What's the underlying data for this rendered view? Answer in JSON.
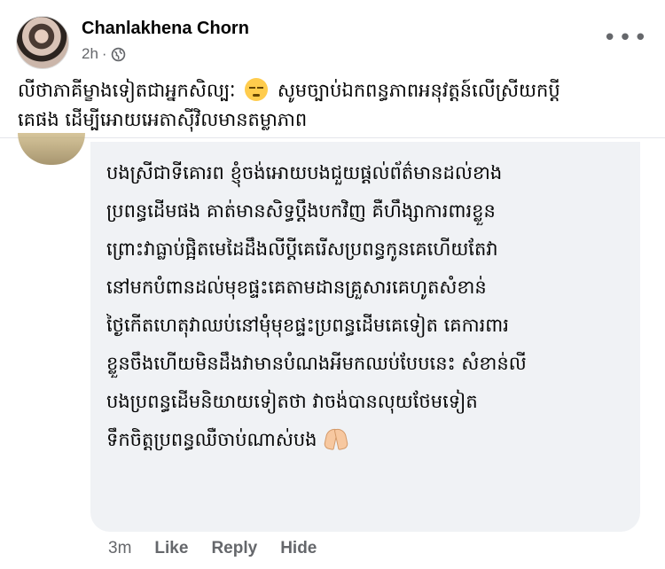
{
  "post": {
    "author": "Chanlakhena Chorn",
    "time": "2h",
    "separator": "·",
    "more_icon": "ellipsis-icon",
    "privacy_icon": "globe-icon",
    "caption_part1": "លីថាភាគីម្ខាងទៀតជាអ្នកសិល្បៈ",
    "caption_part2": "សូមច្បាប់ឯកពន្ធភាពអនុវត្តន៍លើស្រីយកប្តី",
    "caption_line2": "គេផង ដើម្បីអោយអេតាសុីវិលមានតម្លាភាព",
    "caption_emoji": "disappointed-face-emoji"
  },
  "comment": {
    "lines": [
      "បងស្រីជាទីគោរព ខ្ញុំចង់អោយបងជួយផ្តល់ព័ត៌មានដល់ខាង",
      "ប្រពន្ធដើមផង គាត់មានសិទ្ធប្តឹងបកវិញ គឺហឹង្សាការពារខ្លួន",
      "ព្រោះវាធ្លាប់ផ្អិតមេដៃដឹងលីប្តីគេរើសប្រពន្ធកូនគេហើយតែវា",
      "នៅមកបំពានដល់មុខផ្ទះគេតាមដានគ្រួសារគេហូតសំខាន់",
      "ថ្ងៃកើតហេតុវាឈប់នៅម៉ុំមុខផ្ទះប្រពន្ធដើមគេទៀត គេការពារ",
      "ខ្លួនចឹងហើយមិនដឹងវាមានបំណងអីមកឈប់បែបនេះ សំខាន់លី",
      "បងប្រពន្ធដើមនិយាយទៀតថា វាចង់បានលុយថែមទៀត",
      "ទឹកចិត្តប្រពន្ធឈឺចាប់ណាស់បង"
    ],
    "end_emoji": "folded-hands-emoji",
    "time": "3m",
    "like_label": "Like",
    "reply_label": "Reply",
    "hide_label": "Hide"
  }
}
